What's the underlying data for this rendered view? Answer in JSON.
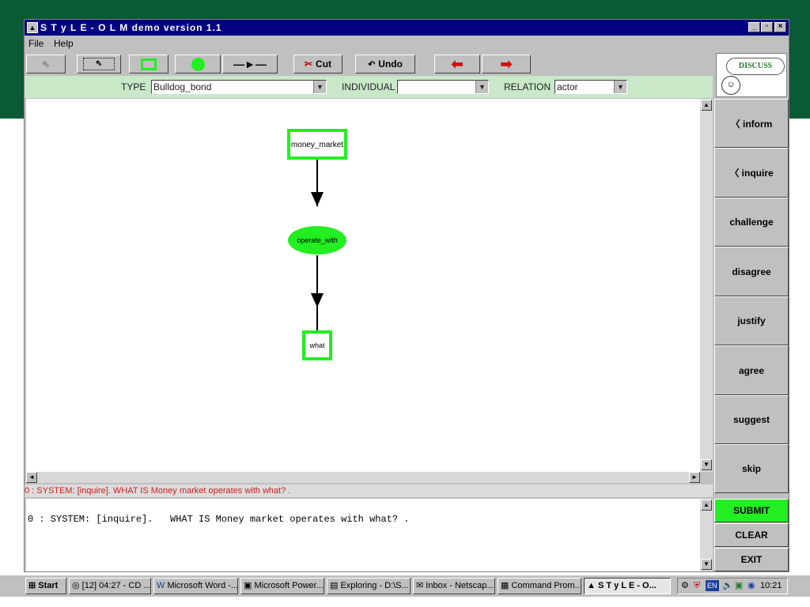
{
  "colors": {
    "band": "#0b5a37",
    "title": "#000080",
    "node_green": "#22ee22",
    "submit_green": "#22ee22",
    "system_text": "#d02020"
  },
  "window": {
    "title": "S T y L E - O L M   demo version 1.1"
  },
  "menu": [
    "File",
    "Help"
  ],
  "toolbar": {
    "cut": "Cut",
    "undo": "Undo"
  },
  "selectors": {
    "type_label": "TYPE",
    "type_value": "Bulldog_bond",
    "individual_label": "INDIVIDUAL",
    "individual_value": "",
    "relation_label": "RELATION",
    "relation_value": "actor"
  },
  "discuss": "DISCUSS",
  "graph": {
    "nodes": [
      {
        "id": "money_market",
        "shape": "rect",
        "label": "money_market"
      },
      {
        "id": "operate_with",
        "shape": "ellipse",
        "label": "operate_with"
      },
      {
        "id": "what",
        "shape": "rect",
        "label": "what"
      }
    ]
  },
  "side_buttons": [
    "〈 inform",
    "〈 inquire",
    "challenge",
    "disagree",
    "justify",
    "agree",
    "suggest",
    "skip"
  ],
  "status_line": "0 : SYSTEM: [inquire].   WHAT IS Money market operates with what? .",
  "dialog_text": "0 : SYSTEM: [inquire].   WHAT IS Money market operates with what? .",
  "bottom_buttons": {
    "submit": "SUBMIT",
    "clear": "CLEAR",
    "exit": "EXIT"
  },
  "taskbar": {
    "start": "Start",
    "tasks": [
      "[12] 04:27 - CD ...",
      "Microsoft Word -...",
      "Microsoft Power...",
      "Exploring - D:\\S...",
      "Inbox - Netscap...",
      "Command Prom...",
      "S T y L E - O..."
    ],
    "clock": "10:21",
    "lang": "EN"
  }
}
